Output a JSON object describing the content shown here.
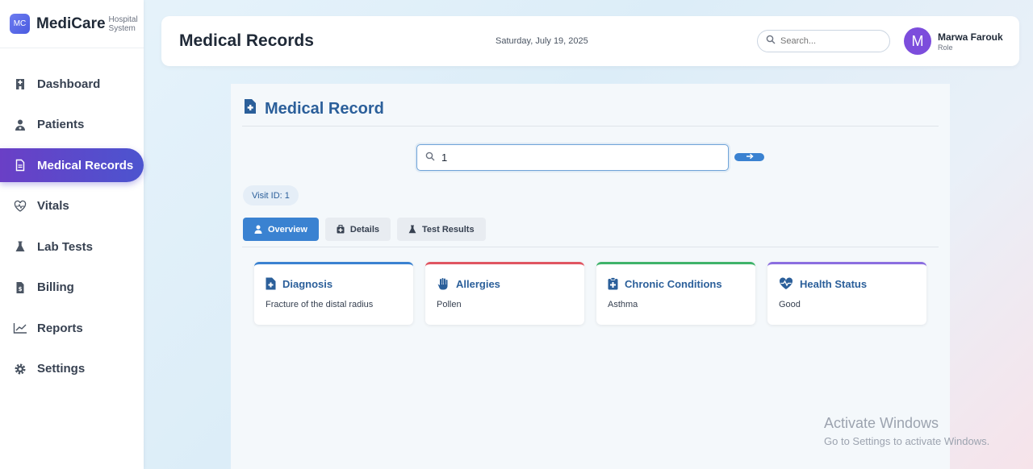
{
  "brand": {
    "logo": "MC",
    "name": "MediCare",
    "sub": "Hospital System"
  },
  "sidebar": {
    "items": [
      {
        "label": "Dashboard",
        "icon": "hospital-icon"
      },
      {
        "label": "Patients",
        "icon": "user-doctor-icon"
      },
      {
        "label": "Medical Records",
        "icon": "file-medical-icon",
        "active": true
      },
      {
        "label": "Vitals",
        "icon": "heart-pulse-icon"
      },
      {
        "label": "Lab Tests",
        "icon": "flask-icon"
      },
      {
        "label": "Billing",
        "icon": "invoice-icon"
      },
      {
        "label": "Reports",
        "icon": "chart-line-icon"
      },
      {
        "label": "Settings",
        "icon": "gear-icon"
      }
    ]
  },
  "header": {
    "title": "Medical Records",
    "date": "Saturday, July 19, 2025",
    "search_placeholder": "Search...",
    "user": {
      "initial": "M",
      "name": "Marwa Farouk",
      "role": "Role"
    }
  },
  "record": {
    "title": "Medical Record",
    "search_value": "1",
    "go_icon": "arrow-right-icon",
    "visit_label": "Visit ID: 1",
    "tabs": [
      {
        "label": "Overview",
        "icon": "user-icon",
        "active": true
      },
      {
        "label": "Details",
        "icon": "medkit-icon"
      },
      {
        "label": "Test Results",
        "icon": "flask-icon"
      }
    ],
    "cards": [
      {
        "title": "Diagnosis",
        "value": "Fracture of the distal radius",
        "accent": "#3a82d1",
        "icon": "file-medical-icon"
      },
      {
        "title": "Allergies",
        "value": "Pollen",
        "accent": "#e05561",
        "icon": "hand-icon"
      },
      {
        "title": "Chronic Conditions",
        "value": "Asthma",
        "accent": "#3fb36a",
        "icon": "clipboard-medical-icon"
      },
      {
        "title": "Health Status",
        "value": "Good",
        "accent": "#8b6ee0",
        "icon": "heart-pulse-icon"
      }
    ]
  },
  "watermark": {
    "line1": "Activate Windows",
    "line2": "Go to Settings to activate Windows."
  },
  "colors": {
    "primary": "#3a82d1",
    "accent_purple": "#6a3fc6",
    "title_blue": "#2b5f9a"
  }
}
